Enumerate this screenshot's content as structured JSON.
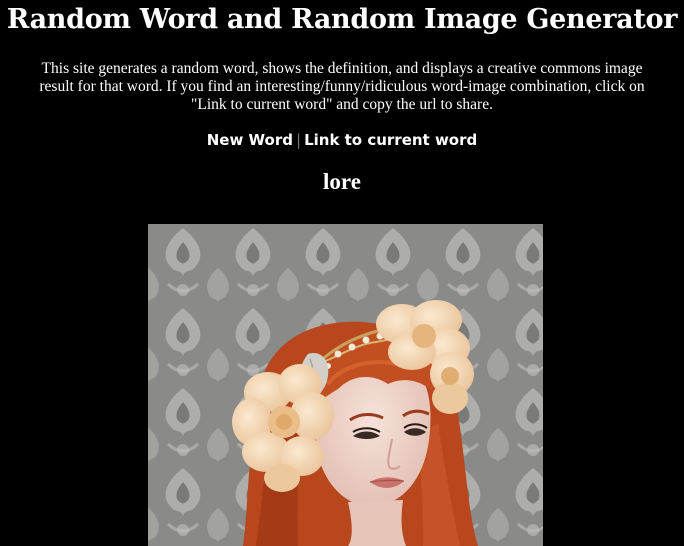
{
  "page": {
    "title": "Random Word and Random Image Generator",
    "intro_line1": "This site generates a random word, shows the definition, and displays a creative commons image",
    "intro_line2": "result for that word. If you find an interesting/funny/ridiculous word-image combination, click on",
    "intro_line3": "\"Link to current word\" and copy the url to share."
  },
  "nav": {
    "new_word_label": "New Word",
    "separator": "|",
    "link_label": "Link to current word"
  },
  "word": {
    "text": "lore"
  },
  "image": {
    "alt": "creative commons image result for the word"
  },
  "colors": {
    "background": "#000000",
    "text": "#ffffff",
    "separator": "#777777"
  }
}
